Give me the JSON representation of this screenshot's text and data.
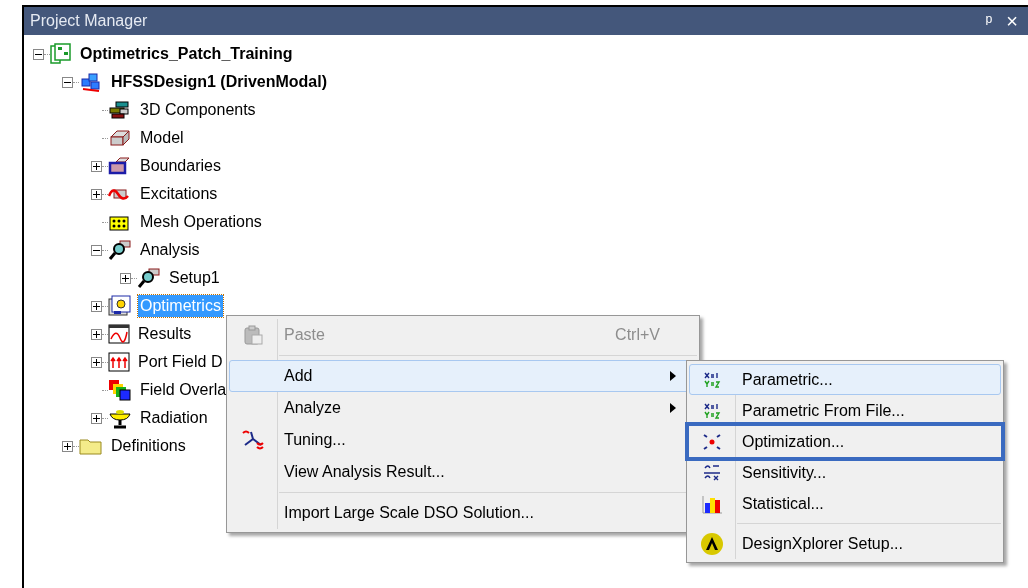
{
  "window": {
    "title": "Project Manager",
    "buttons": [
      "ᵖ",
      "×"
    ]
  },
  "tree": [
    {
      "label": "Optimetrics_Patch_Training",
      "bold": true,
      "expanded": true,
      "selected": false,
      "children": [
        {
          "label": "HFSSDesign1 (DrivenModal)",
          "bold": true,
          "expanded": true,
          "selected": false,
          "children": [
            {
              "label": "3D Components",
              "selected": false
            },
            {
              "label": "Model",
              "selected": false
            },
            {
              "label": "Boundaries",
              "expanded": false,
              "selected": false
            },
            {
              "label": "Excitations",
              "expanded": false,
              "selected": false
            },
            {
              "label": "Mesh Operations",
              "selected": false
            },
            {
              "label": "Analysis",
              "expanded": true,
              "selected": false,
              "children": [
                {
                  "label": "Setup1",
                  "expanded": false,
                  "selected": false
                }
              ]
            },
            {
              "label": "Optimetrics",
              "expanded": false,
              "selected": true
            },
            {
              "label": "Results",
              "expanded": false,
              "selected": false
            },
            {
              "label": "Port Field D",
              "expanded": false,
              "selected": false
            },
            {
              "label": "Field Overla",
              "selected": false
            },
            {
              "label": "Radiation",
              "expanded": false,
              "selected": false
            }
          ]
        },
        {
          "label": "Definitions",
          "expanded": false,
          "selected": false
        }
      ]
    }
  ],
  "context_menu": {
    "items": [
      {
        "kind": "item",
        "label": "Paste",
        "shortcut": "Ctrl+V",
        "disabled": true,
        "highlighted": false
      },
      {
        "kind": "separator"
      },
      {
        "kind": "item",
        "label": "Add",
        "submenu": true,
        "disabled": false,
        "highlighted": true
      },
      {
        "kind": "item",
        "label": "Analyze",
        "submenu": true,
        "disabled": false,
        "highlighted": false
      },
      {
        "kind": "item",
        "label": "Tuning...",
        "disabled": false,
        "highlighted": false
      },
      {
        "kind": "item",
        "label": "View Analysis Result...",
        "disabled": false,
        "highlighted": false
      },
      {
        "kind": "separator"
      },
      {
        "kind": "item",
        "label": "Import Large Scale DSO Solution...",
        "disabled": false,
        "highlighted": false
      }
    ]
  },
  "submenu": {
    "items": [
      {
        "kind": "item",
        "label": "Parametric...",
        "highlighted": true,
        "outlined": false
      },
      {
        "kind": "item",
        "label": "Parametric From File...",
        "highlighted": false,
        "outlined": false
      },
      {
        "kind": "item",
        "label": "Optimization...",
        "highlighted": false,
        "outlined": true
      },
      {
        "kind": "item",
        "label": "Sensitivity...",
        "highlighted": false,
        "outlined": false
      },
      {
        "kind": "item",
        "label": "Statistical...",
        "highlighted": false,
        "outlined": false
      },
      {
        "kind": "separator"
      },
      {
        "kind": "item",
        "label": "DesignXplorer Setup...",
        "highlighted": false,
        "outlined": false
      }
    ]
  }
}
